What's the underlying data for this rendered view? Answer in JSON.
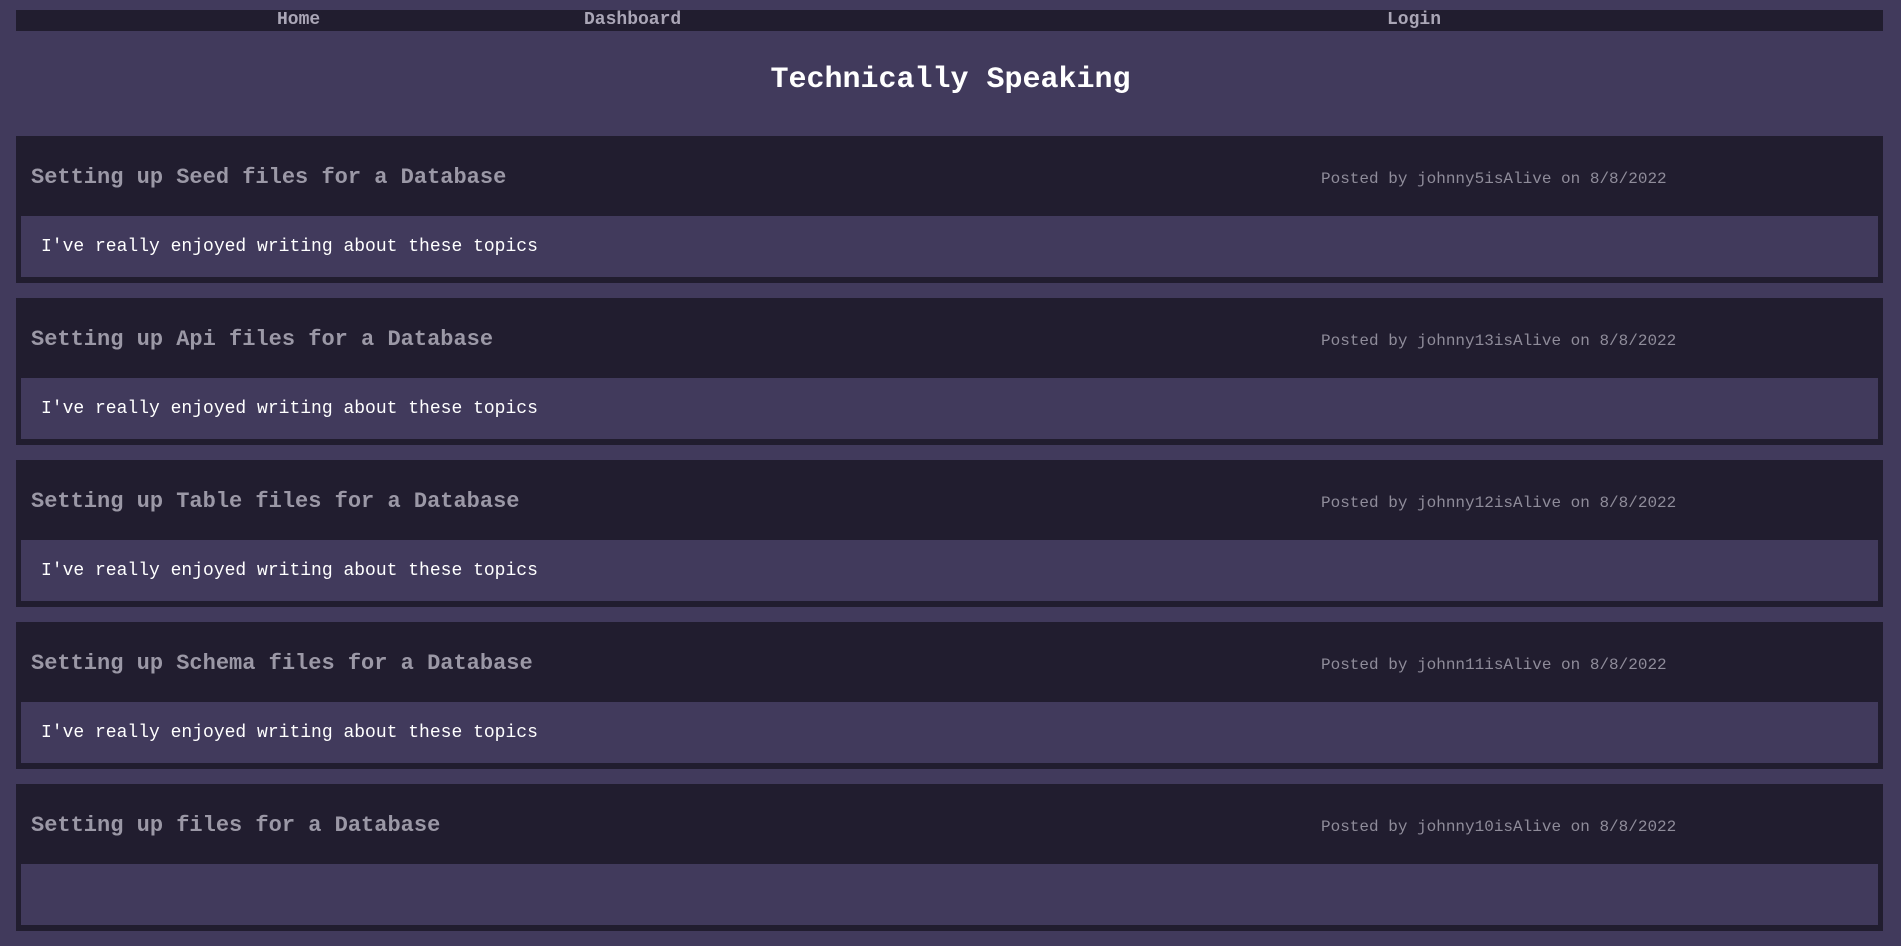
{
  "nav": {
    "home_label": "Home",
    "dashboard_label": "Dashboard",
    "login_label": "Login"
  },
  "site": {
    "title": "Technically Speaking"
  },
  "posts": [
    {
      "title": "Setting up Seed files for a Database",
      "meta": "Posted by johnny5isAlive on 8/8/2022",
      "body": "I've really enjoyed writing about these topics"
    },
    {
      "title": "Setting up Api files for a Database",
      "meta": "Posted by johnny13isAlive on 8/8/2022",
      "body": "I've really enjoyed writing about these topics"
    },
    {
      "title": "Setting up Table files for a Database",
      "meta": "Posted by johnny12isAlive on 8/8/2022",
      "body": "I've really enjoyed writing about these topics"
    },
    {
      "title": "Setting up Schema files for a Database",
      "meta": "Posted by johnn11isAlive on 8/8/2022",
      "body": "I've really enjoyed writing about these topics"
    },
    {
      "title": "Setting up files for a Database",
      "meta": "Posted by johnny10isAlive on 8/8/2022",
      "body": ""
    }
  ],
  "colors": {
    "page_background": "#413a5c",
    "card_background": "#211d2f",
    "title_text": "#ffffff",
    "post_title_text": "#9b98a6",
    "meta_text": "#8f8c9a"
  }
}
